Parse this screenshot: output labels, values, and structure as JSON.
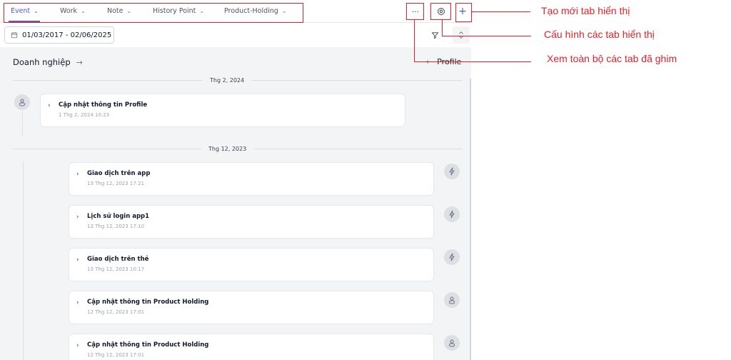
{
  "tabs": [
    {
      "label": "Event",
      "active": true
    },
    {
      "label": "Work",
      "active": false
    },
    {
      "label": "Note",
      "active": false
    },
    {
      "label": "History Point",
      "active": false
    },
    {
      "label": "Product-Holding",
      "active": false
    }
  ],
  "toolbar": {
    "more_label": "···",
    "add_label": "+"
  },
  "date_range": "01/03/2017 - 02/06/2025",
  "section_title": "Doanh nghiệp",
  "profile_link": "Profile",
  "months": [
    {
      "label": "Thg 2, 2024",
      "events": [
        {
          "title": "Cập nhật thông tin Profile",
          "time": "1 Thg 2, 2024 10:23",
          "icon": "user-icon"
        }
      ]
    },
    {
      "label": "Thg 12, 2023",
      "events": [
        {
          "title": "Giao dịch trên app",
          "time": "13 Thg 12, 2023 17:21",
          "icon": "lightning-icon"
        },
        {
          "title": "Lịch sử login app1",
          "time": "13 Thg 12, 2023 17:10",
          "icon": "lightning-icon"
        },
        {
          "title": "Giao dịch trên thẻ",
          "time": "13 Thg 12, 2023 10:17",
          "icon": "lightning-icon"
        },
        {
          "title": "Cập nhật thông tin Product Holding",
          "time": "12 Thg 12, 2023 17:01",
          "icon": "user-icon"
        },
        {
          "title": "Cập nhật thông tin Product Holding",
          "time": "12 Thg 12, 2023 17:01",
          "icon": "user-icon"
        }
      ]
    }
  ],
  "annotations": {
    "add_tab": "Tạo mới tab hiển thị",
    "config_tabs": "Cấu hình các tab hiển thị",
    "view_pinned": "Xem toàn bộ các tab đã ghim"
  },
  "colors": {
    "accent": "#4f5bd5",
    "annotation": "#e8202a",
    "panel_bg": "#f3f4f6"
  }
}
